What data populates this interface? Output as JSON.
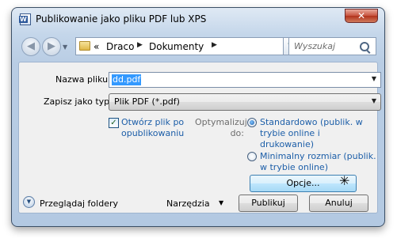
{
  "window": {
    "title": "Publikowanie jako pliku PDF lub XPS",
    "close_symbol": "✕"
  },
  "nav": {
    "back_symbol": "◀",
    "forward_symbol": "▶",
    "history_symbol": "▼",
    "breadcrumb": {
      "prefix": "«",
      "items": [
        "Draco",
        "Dokumenty"
      ],
      "separator": "▶"
    },
    "refresh_symbol": "↻",
    "search_placeholder": "Wyszukaj"
  },
  "form": {
    "filename_label": "Nazwa pliku:",
    "filename_value": "dd.pdf",
    "filetype_label": "Zapisz jako typ:",
    "filetype_value": "Plik PDF (*.pdf)",
    "open_after_publish": {
      "checked": true,
      "check_symbol": "✓",
      "label_line1": "Otwórz plik po",
      "label_line2": "opublikowaniu"
    },
    "optimize_label_line1": "Optymalizuj",
    "optimize_label_line2": "do:",
    "options": [
      {
        "line1": "Standardowo (publik. w",
        "line2": "trybie online i",
        "line3": "drukowanie)",
        "selected": true
      },
      {
        "line1": "Minimalny rozmiar (publik.",
        "line2": "w trybie online)",
        "selected": false
      }
    ],
    "options_button": "Opcje..."
  },
  "footer": {
    "browse_folders": "Przeglądaj foldery",
    "browse_symbol": "▼",
    "tools": "Narzędzia",
    "tools_arrow": "▼",
    "publish_button": "Publikuj",
    "cancel_button": "Anuluj"
  },
  "colors": {
    "link_text": "#1c5ea8",
    "selection": "#3399ff",
    "chrome": "#b9cde4"
  }
}
